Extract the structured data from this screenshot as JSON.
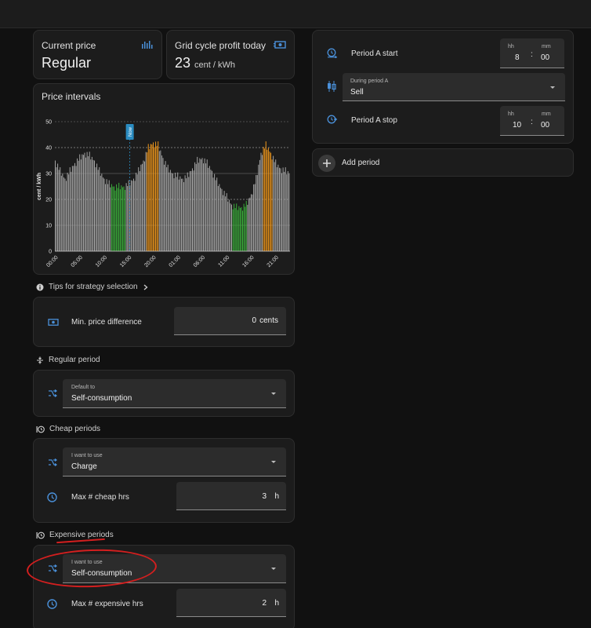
{
  "colors": {
    "accent": "#4a90d9",
    "cheap": "#3bb33b",
    "expensive": "#f59a1a",
    "regular": "#a8a8a8",
    "now": "#2a8bc0",
    "annotation": "#d31f1f"
  },
  "icons": {
    "current_price": "bar-chart-icon",
    "grid_profit": "cash-icon",
    "period_start": "clock-start-icon",
    "during_period": "candlestick-icon",
    "period_stop": "clock-stop-icon",
    "add_period": "plus-icon",
    "info": "info-icon",
    "chevron": "chevron-right-icon",
    "min_price": "cash-icon",
    "regular": "split-icon",
    "cheap": "clock-history-icon",
    "expensive": "clock-history-icon",
    "strategy": "shuffle-icon",
    "hours": "clock-icon"
  },
  "current_price": {
    "title": "Current price",
    "value": "Regular"
  },
  "grid_profit": {
    "title": "Grid cycle profit today",
    "value": "23",
    "unit": "cent / kWh"
  },
  "price_intervals": {
    "title": "Price intervals"
  },
  "tips": {
    "label": "Tips for strategy selection"
  },
  "min_price": {
    "label": "Min. price difference",
    "value": "0",
    "unit": "cents"
  },
  "regular_period": {
    "label": "Regular period",
    "field_label": "Default to",
    "value": "Self-consumption"
  },
  "cheap_periods": {
    "label": "Cheap periods",
    "field_label": "I want to use",
    "value": "Charge",
    "max_label": "Max # cheap hrs",
    "max_value": "3",
    "max_unit": "h"
  },
  "expensive_periods": {
    "label": "Expensive periods",
    "field_label": "I want to use",
    "value": "Self-consumption",
    "max_label": "Max # expensive hrs",
    "max_value": "2",
    "max_unit": "h"
  },
  "period_a": {
    "start_label": "Period A start",
    "start_hh_label": "hh",
    "start_hh": "8",
    "start_mm_label": "mm",
    "start_mm": "00",
    "during_label": "During period A",
    "during_value": "Sell",
    "stop_label": "Period A stop",
    "stop_hh_label": "hh",
    "stop_hh": "10",
    "stop_mm_label": "mm",
    "stop_mm": "00",
    "sep": ":"
  },
  "add_period": {
    "label": "Add period"
  },
  "chart_data": {
    "type": "bar",
    "title": "",
    "ylabel": "cent / kWh",
    "xlabel": "",
    "ylim": [
      0,
      50
    ],
    "yticks": [
      "0",
      "10",
      "20",
      "30",
      "40",
      "50"
    ],
    "xticks": [
      "00:00",
      "05:00",
      "10:00",
      "15:00",
      "20:00",
      "01:00",
      "06:00",
      "11:00",
      "16:00",
      "21:00"
    ],
    "now_label": "Now",
    "now_hour": 15.3,
    "interval_hours": 0.25,
    "hours_total": 48,
    "profile": [
      [
        0,
        35
      ],
      [
        1,
        31
      ],
      [
        2,
        28
      ],
      [
        3,
        31
      ],
      [
        4,
        34
      ],
      [
        5,
        36
      ],
      [
        6,
        38
      ],
      [
        7,
        37
      ],
      [
        8,
        35
      ],
      [
        9,
        31
      ],
      [
        10,
        28
      ],
      [
        11,
        26
      ],
      [
        12,
        25
      ],
      [
        13,
        25
      ],
      [
        14,
        25
      ],
      [
        15,
        26
      ],
      [
        16,
        28
      ],
      [
        17,
        31
      ],
      [
        18,
        35
      ],
      [
        19,
        40
      ],
      [
        20,
        42
      ],
      [
        21,
        41
      ],
      [
        22,
        36
      ],
      [
        23,
        32
      ],
      [
        24,
        30
      ],
      [
        25,
        29
      ],
      [
        26,
        28
      ],
      [
        27,
        29
      ],
      [
        28,
        32
      ],
      [
        29,
        35
      ],
      [
        30,
        36
      ],
      [
        31,
        34
      ],
      [
        32,
        31
      ],
      [
        33,
        27
      ],
      [
        34,
        24
      ],
      [
        35,
        21
      ],
      [
        36,
        18
      ],
      [
        37,
        17
      ],
      [
        38,
        17
      ],
      [
        39,
        18
      ],
      [
        40,
        22
      ],
      [
        41,
        28
      ],
      [
        42,
        38
      ],
      [
        43,
        41
      ],
      [
        44,
        38
      ],
      [
        45,
        34
      ],
      [
        46,
        32
      ],
      [
        47,
        31
      ],
      [
        48,
        30
      ]
    ],
    "segments": [
      {
        "from": 11.5,
        "to": 14.5,
        "class": "cheap"
      },
      {
        "from": 18.75,
        "to": 21.25,
        "class": "expensive"
      },
      {
        "from": 36.25,
        "to": 39.25,
        "class": "cheap"
      },
      {
        "from": 42.5,
        "to": 44.5,
        "class": "expensive"
      }
    ]
  }
}
